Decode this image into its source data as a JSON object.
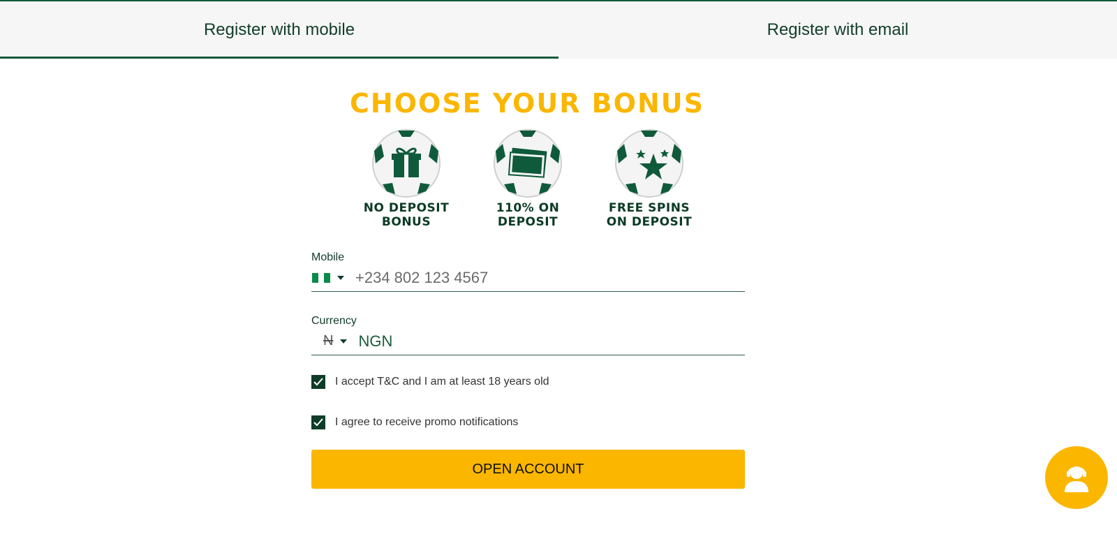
{
  "tabs": [
    {
      "label": "Register with mobile",
      "active": true
    },
    {
      "label": "Register with email",
      "active": false
    }
  ],
  "promo": {
    "title": "CHOOSE YOUR BONUS",
    "bonuses": [
      {
        "label": "NO DEPOSIT\nBONUS",
        "icon": "gift-icon"
      },
      {
        "label": "110% ON\nDEPOSIT",
        "icon": "banknotes-icon"
      },
      {
        "label": "FREE SPINS\nON DEPOSIT",
        "icon": "stars-icon"
      }
    ]
  },
  "form": {
    "mobile": {
      "label": "Mobile",
      "placeholder": "+234 802 123 4567",
      "country_flag": "nigeria-flag-icon"
    },
    "currency": {
      "label": "Currency",
      "symbol": "N",
      "value": "NGN"
    },
    "terms": {
      "label": "I accept T&C and I am at least 18 years old",
      "checked": true
    },
    "promo_notifications": {
      "label": "I agree to receive promo notifications",
      "checked": true
    },
    "submit_label": "OPEN ACCOUNT"
  },
  "support": {
    "icon": "support-agent-icon"
  },
  "colors": {
    "accent": "#fbb600",
    "brand_green": "#0f5a3a",
    "dark_green": "#0f3d27"
  }
}
